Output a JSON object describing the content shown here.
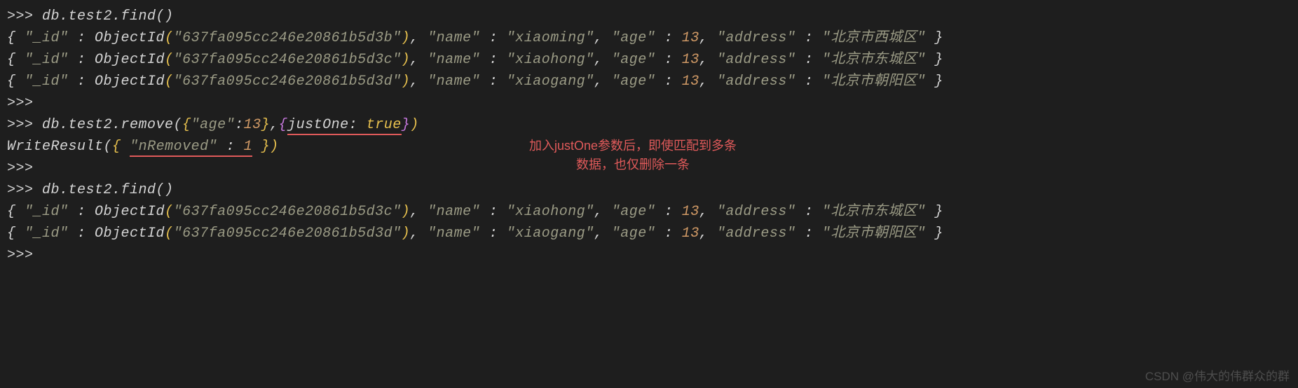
{
  "prompt": ">>>",
  "cmd_find": "db.test2.find()",
  "cmd_remove_prefix": "db.test2.remove(",
  "justone_key": "justOne: ",
  "justone_val": "true",
  "write_result_prefix": "WriteResult(",
  "nremoved_key": "\"nRemoved\"",
  "nremoved_val": "1",
  "doc_keys": {
    "id": "\"_id\"",
    "name": "\"name\"",
    "age": "\"age\"",
    "address": "\"address\""
  },
  "age_key_q": "\"age\"",
  "age_num": "13",
  "objectid": "ObjectId",
  "docs_before": [
    {
      "oid": "\"637fa095cc246e20861b5d3b\"",
      "name": "\"xiaoming\"",
      "age": "13",
      "address": "\"北京市西城区\""
    },
    {
      "oid": "\"637fa095cc246e20861b5d3c\"",
      "name": "\"xiaohong\"",
      "age": "13",
      "address": "\"北京市东城区\""
    },
    {
      "oid": "\"637fa095cc246e20861b5d3d\"",
      "name": "\"xiaogang\"",
      "age": "13",
      "address": "\"北京市朝阳区\""
    }
  ],
  "docs_after": [
    {
      "oid": "\"637fa095cc246e20861b5d3c\"",
      "name": "\"xiaohong\"",
      "age": "13",
      "address": "\"北京市东城区\""
    },
    {
      "oid": "\"637fa095cc246e20861b5d3d\"",
      "name": "\"xiaogang\"",
      "age": "13",
      "address": "\"北京市朝阳区\""
    }
  ],
  "annotation_line1": "加入justOne参数后，即使匹配到多条",
  "annotation_line2": "数据，也仅删除一条",
  "watermark": "CSDN @伟大的伟群众的群"
}
